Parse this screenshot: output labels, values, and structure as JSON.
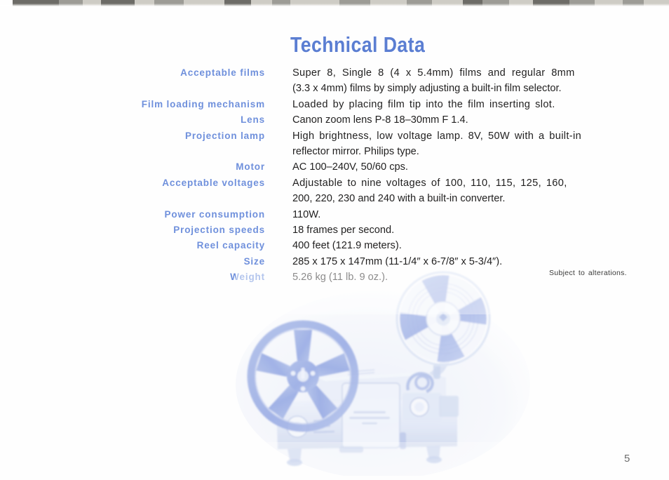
{
  "page": {
    "title": "Technical Data",
    "number": "5",
    "note": "Subject to alterations.",
    "accent_color": "#6f90dc",
    "title_color": "#5b7ed2",
    "body_color": "#201f1f",
    "background": "#fefefe"
  },
  "specs": [
    {
      "label": "Acceptable films",
      "lines": [
        "Super  8,  Single  8  (4 x 5.4mm)  films  and  regular  8mm",
        "(3.3 x 4mm) films by simply adjusting a built-in film selector."
      ]
    },
    {
      "label": "Film loading mechanism",
      "lines": [
        "Loaded  by  placing  film  tip  into  the  film  inserting  slot."
      ]
    },
    {
      "label": "Lens",
      "lines": [
        "Canon zoom lens P-8 18–30mm F 1.4."
      ]
    },
    {
      "label": "Projection lamp",
      "lines": [
        "High  brightness,  low  voltage  lamp.  8V,  50W  with  a  built-in",
        "reflector mirror.   Philips type."
      ]
    },
    {
      "label": "Motor",
      "lines": [
        "AC  100–240V,  50/60 cps."
      ]
    },
    {
      "label": "Acceptable voltages",
      "lines": [
        "Adjustable  to  nine  voltages  of  100,  110,  115,  125,  160,",
        "200, 220, 230 and 240 with a built-in converter."
      ]
    },
    {
      "label": "Power consumption",
      "lines": [
        "110W."
      ]
    },
    {
      "label": "Projection speeds",
      "lines": [
        "18 frames per second."
      ]
    },
    {
      "label": "Reel capacity",
      "lines": [
        "400 feet (121.9 meters)."
      ]
    },
    {
      "label": "Size",
      "lines": [
        "285 x 175 x 147mm  (11-1/4″ x 6-7/8″ x 5-3/4″)."
      ]
    },
    {
      "label": "Weight",
      "lines": [
        "5.26 kg  (11 lb.  9 oz.)."
      ]
    }
  ],
  "illustration": {
    "name": "film-projector-photo",
    "description": "Faded blue duotone photograph of an 8mm film projector with a large flat five-spoke supply reel on the left and a take-up reel raised on an arm at upper right."
  }
}
